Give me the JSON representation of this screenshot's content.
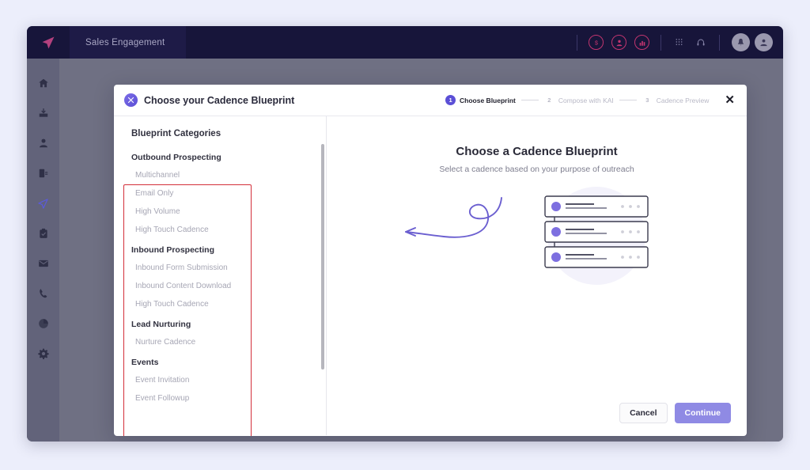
{
  "topnav": {
    "logo_icon": "paper-plane-logo",
    "app_title": "Sales Engagement",
    "right_icons": [
      {
        "name": "dollar-circle-icon",
        "glyph": "$"
      },
      {
        "name": "person-circle-icon",
        "glyph": "●"
      },
      {
        "name": "chart-circle-icon",
        "glyph": "▮"
      },
      {
        "name": "dialpad-icon",
        "glyph": "∷"
      },
      {
        "name": "headset-icon",
        "glyph": "○"
      },
      {
        "name": "notifications-avatar",
        "glyph": "🔔"
      },
      {
        "name": "user-avatar",
        "glyph": "👤"
      }
    ]
  },
  "left_rail": {
    "items": [
      {
        "name": "home-icon",
        "active": false
      },
      {
        "name": "inbox-icon",
        "active": false
      },
      {
        "name": "contacts-icon",
        "active": false
      },
      {
        "name": "documents-icon",
        "active": false
      },
      {
        "name": "cadence-icon",
        "active": true
      },
      {
        "name": "clipboard-icon",
        "active": false
      },
      {
        "name": "mail-icon",
        "active": false
      },
      {
        "name": "phone-icon",
        "active": false
      },
      {
        "name": "analytics-icon",
        "active": false
      },
      {
        "name": "settings-icon",
        "active": false
      }
    ]
  },
  "modal": {
    "header_icon": "cadence-blueprint-icon",
    "title": "Choose your Cadence Blueprint",
    "close_label": "✕",
    "stepper": [
      {
        "number": "1",
        "label": "Choose Blueprint",
        "state": "active"
      },
      {
        "number": "2",
        "label": "Compose with KAI",
        "state": "inactive"
      },
      {
        "number": "3",
        "label": "Cadence Preview",
        "state": "inactive"
      }
    ],
    "sidebar": {
      "heading": "Blueprint Categories",
      "highlight_color": "#d32f3a",
      "groups": [
        {
          "title": "Outbound Prospecting",
          "items": [
            "Multichannel",
            "Email Only",
            "High Volume",
            "High Touch Cadence"
          ]
        },
        {
          "title": "Inbound Prospecting",
          "items": [
            "Inbound Form Submission",
            "Inbound Content Download",
            "High Touch Cadence"
          ]
        },
        {
          "title": "Lead Nurturing",
          "items": [
            "Nurture Cadence"
          ]
        },
        {
          "title": "Events",
          "items": [
            "Event Invitation",
            "Event Followup"
          ]
        }
      ]
    },
    "main": {
      "title": "Choose a Cadence Blueprint",
      "subtitle": "Select a cadence based on your purpose of outreach",
      "illustration": {
        "name": "cadence-cards-illustration",
        "arrow_color": "#6b5fd0",
        "dot_color": "#7d6fe0",
        "card_count": 3
      }
    },
    "footer": {
      "cancel_label": "Cancel",
      "continue_label": "Continue",
      "continue_color": "#8f8ae4"
    }
  }
}
